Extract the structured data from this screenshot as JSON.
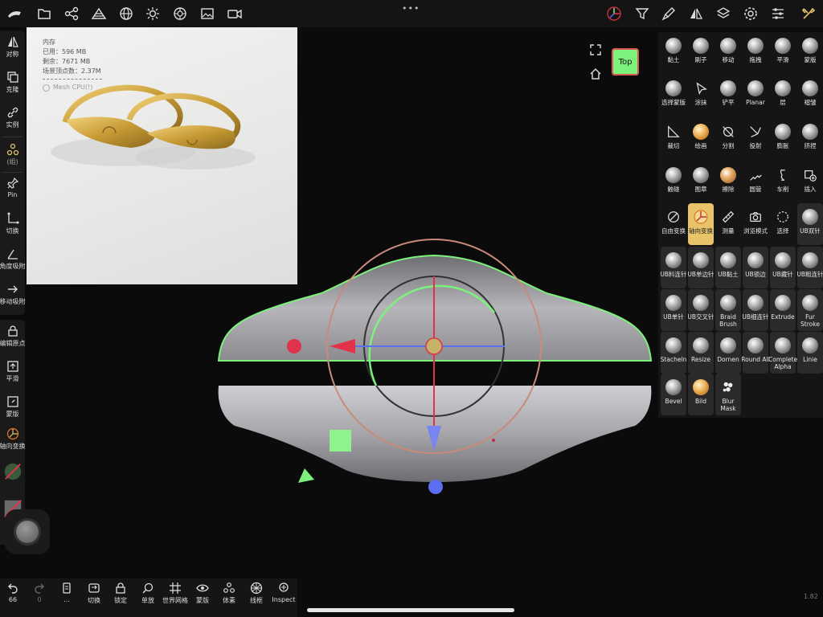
{
  "memory": {
    "title": "内存",
    "used": "已用：596 MB",
    "free": "剩余：7671 MB",
    "vertices": "场景顶点数：2.37M",
    "mesh_label": "Mesh CPU(!)"
  },
  "viewcube": {
    "label": "Top"
  },
  "left_tools": [
    {
      "label": "对称"
    },
    {
      "label": "克隆"
    },
    {
      "label": "实例"
    },
    {
      "label": "(组)"
    },
    {
      "label": "Pin"
    },
    {
      "label": "切换"
    },
    {
      "label": "角度吸附"
    },
    {
      "label": "移动吸附"
    },
    {
      "label": "编辑原点"
    },
    {
      "label": "平滑"
    },
    {
      "label": "蒙版"
    },
    {
      "label": "轴向变换"
    }
  ],
  "brushes": {
    "row1": [
      "黏土",
      "刷子",
      "移动",
      "拖拽",
      "平滑",
      "蒙版"
    ],
    "row2": [
      "选择蒙版",
      "涂抹",
      "铲平",
      "Planar",
      "层",
      "褶皱"
    ],
    "row3": [
      "裁切",
      "绘画",
      "分割",
      "投射",
      "膨胀",
      "挤捏"
    ],
    "row4": [
      "触碰",
      "图章",
      "擦除",
      "圆管",
      "车削",
      "插入"
    ],
    "row5": [
      "自由变换",
      "轴向变换",
      "测量",
      "浏览模式",
      "选择",
      "UB双针"
    ],
    "row6": [
      "UB料连针",
      "UB单边针",
      "UB黏土",
      "UB锁边",
      "UB藏针",
      "UB粗连针"
    ],
    "row7": [
      "UB单针",
      "UB交叉针",
      "Braid Brush",
      "UB细连针",
      "Extrude",
      "Fur Stroke"
    ],
    "row8": [
      "Stacheln",
      "Resize",
      "Dornen",
      "Round All",
      "Complete Alpha",
      "Linie"
    ],
    "row9": [
      "Bevel",
      "Bild",
      "Blur Mask"
    ]
  },
  "bottom_tools": [
    {
      "label": "66"
    },
    {
      "label": "0"
    },
    {
      "label": "..."
    },
    {
      "label": "切换"
    },
    {
      "label": "锁定"
    },
    {
      "label": "单放"
    },
    {
      "label": "世界网格"
    },
    {
      "label": "蒙版"
    },
    {
      "label": "体素"
    },
    {
      "label": "线框"
    },
    {
      "label": "Inspect"
    }
  ],
  "version": "1.82",
  "colors": {
    "accent_gold": "#e7c36a",
    "gizmo_red": "#e0324a",
    "gizmo_blue": "#5b6ff0",
    "gizmo_green": "#7CF27C",
    "selection_outline": "#7CF27C",
    "ring_pink": "#c98a7a"
  },
  "top_icons": [
    "app-logo-icon",
    "folder-icon",
    "share-icon",
    "scene-icon",
    "globe-icon",
    "sun-icon",
    "material-icon",
    "image-icon",
    "video-icon",
    "gizmo-icon",
    "filter-icon",
    "brush-icon",
    "symmetry-icon",
    "layers-icon",
    "gear-icon",
    "sliders-icon",
    "tools-icon"
  ]
}
